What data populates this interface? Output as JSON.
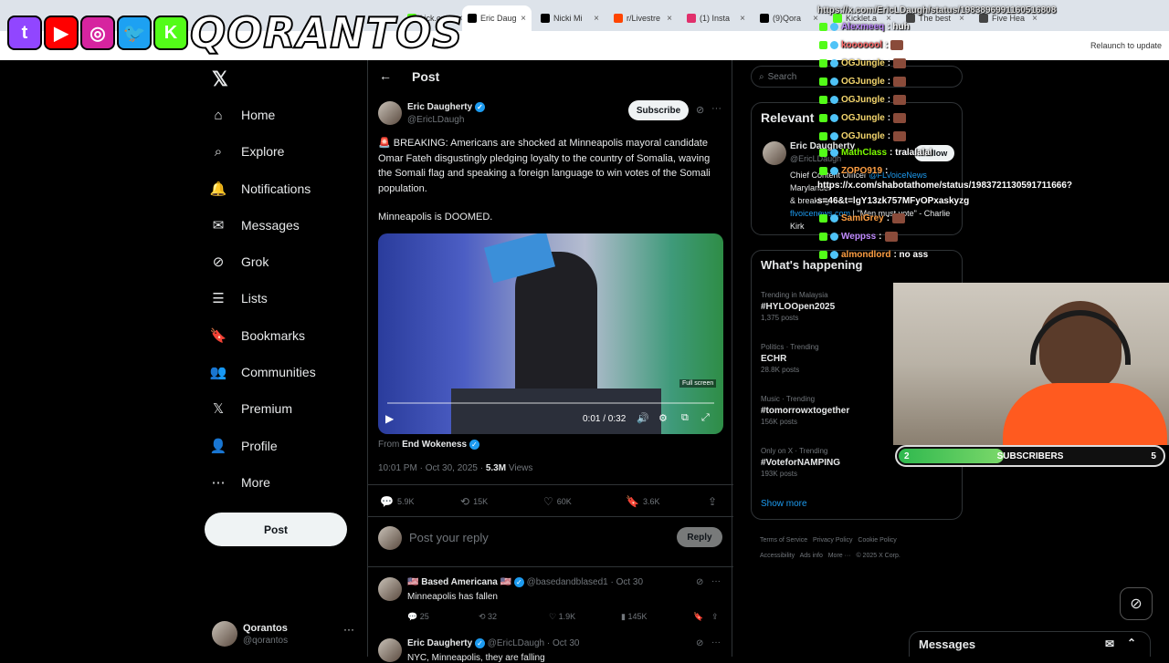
{
  "browser": {
    "tabs": [
      {
        "label": "kick.com",
        "color": "#53fc18"
      },
      {
        "label": "Eric Daug",
        "color": "#000000",
        "active": true
      },
      {
        "label": "Nicki Mi",
        "color": "#000000"
      },
      {
        "label": "r/Livestre",
        "color": "#ff4500"
      },
      {
        "label": "(1) Insta",
        "color": "#e1306c"
      },
      {
        "label": "(9)Qora",
        "color": "#000000"
      },
      {
        "label": "Kicklet.a",
        "color": "#53fc18"
      },
      {
        "label": "The best",
        "color": "#444444"
      },
      {
        "label": "Five Hea",
        "color": "#444444"
      }
    ],
    "relaunch_label": "Relaunch to update"
  },
  "overlay": {
    "logo_text": "QORANTOS",
    "icons": [
      {
        "name": "twitch-icon",
        "glyph": "t",
        "color": "#9146ff"
      },
      {
        "name": "youtube-icon",
        "glyph": "▶",
        "color": "#ff0000"
      },
      {
        "name": "instagram-icon",
        "glyph": "◎",
        "color": "#d6249f"
      },
      {
        "name": "twitter-icon",
        "glyph": "🐦",
        "color": "#1da1f2"
      },
      {
        "name": "kick-icon",
        "glyph": "K",
        "color": "#53fc18"
      }
    ]
  },
  "nav": {
    "items": [
      {
        "label": "Home",
        "icon": "⌂"
      },
      {
        "label": "Explore",
        "icon": "⌕"
      },
      {
        "label": "Notifications",
        "icon": "🔔"
      },
      {
        "label": "Messages",
        "icon": "✉"
      },
      {
        "label": "Grok",
        "icon": "⊘"
      },
      {
        "label": "Lists",
        "icon": "☰"
      },
      {
        "label": "Bookmarks",
        "icon": "🔖"
      },
      {
        "label": "Communities",
        "icon": "👥"
      },
      {
        "label": "Premium",
        "icon": "𝕏"
      },
      {
        "label": "Profile",
        "icon": "👤"
      },
      {
        "label": "More",
        "icon": "⋯"
      }
    ],
    "post_label": "Post",
    "account_name": "Qorantos",
    "account_handle": "@qorantos"
  },
  "post": {
    "header": "Post",
    "author": "Eric Daugherty",
    "handle": "@EricLDaugh",
    "subscribe_label": "Subscribe",
    "text1": "🚨 BREAKING: Americans are shocked at Minneapolis mayoral candidate Omar Fateh disgustingly pledging loyalty to the country of Somalia, waving the Somali flag and speaking a foreign language to win votes of the Somali population.",
    "text2": "Minneapolis is DOOMED.",
    "video_time": "0:01 / 0:32",
    "fullscreen_tooltip": "Full screen",
    "from_label": "From",
    "from_source": "End Wokeness",
    "timestamp": "10:01 PM · Oct 30, 2025 ·",
    "views_count": "5.3M",
    "views_label": "Views",
    "replies": "5.9K",
    "reposts": "15K",
    "likes": "60K",
    "bookmarks": "3.6K",
    "reply_placeholder": "Post your reply",
    "reply_button": "Reply"
  },
  "replies": [
    {
      "author": "🇺🇸 Based Americana 🇺🇸",
      "handle": "@basedandblased1 · Oct 30",
      "text": "Minneapolis has fallen",
      "replies": "25",
      "reposts": "32",
      "likes": "1.9K",
      "views": "145K"
    },
    {
      "author": "Eric Daugherty",
      "handle": "@EricLDaugh · Oct 30",
      "text": "NYC, Minneapolis, they are falling"
    }
  ],
  "sidebar": {
    "search_placeholder": "Search",
    "relevant_title": "Relevant",
    "relevant_name": "Eric Daugherty",
    "relevant_handle": "@EricLDaugh",
    "relevant_bio1": "Chief Content Officer",
    "relevant_bio_link": "@FLVoiceNews",
    "relevant_bio2": "Marylander",
    "relevant_bio3": "& breaking",
    "relevant_site": "flvoicenews.com",
    "relevant_quote": "| \"Men must vote\" - Charlie Kirk",
    "follow_label": "Follow",
    "happening_title": "What's happening",
    "trends": [
      {
        "meta": "Trending in Malaysia",
        "title": "#HYLOOpen2025",
        "count": "1,375 posts"
      },
      {
        "meta": "Politics · Trending",
        "title": "ECHR",
        "count": "28.8K posts"
      },
      {
        "meta": "Music · Trending",
        "title": "#tomorrowxtogether",
        "count": "156K posts"
      },
      {
        "meta": "Only on X · Trending",
        "title": "#VoteforNAMPING",
        "count": "193K posts"
      }
    ],
    "show_more": "Show more",
    "footer": [
      "Terms of Service",
      "Privacy Policy",
      "Cookie Policy",
      "Accessibility",
      "Ads info",
      "More ···",
      "© 2025 X Corp."
    ]
  },
  "chat": [
    {
      "user": "Alexmeeq",
      "msg": ": huh",
      "color": "#c08bff"
    },
    {
      "user": "kooooool",
      "msg": ":",
      "color": "#ff6b6b",
      "emote": true
    },
    {
      "user": "OGJungle",
      "msg": ":",
      "color": "#f5d76e",
      "emote": true
    },
    {
      "user": "OGJungle",
      "msg": ":",
      "color": "#f5d76e",
      "emote": true
    },
    {
      "user": "OGJungle",
      "msg": ":",
      "color": "#f5d76e",
      "emote": true
    },
    {
      "user": "OGJungle",
      "msg": ":",
      "color": "#f5d76e",
      "emote": true
    },
    {
      "user": "OGJungle",
      "msg": ":",
      "color": "#f5d76e",
      "emote": true
    },
    {
      "user": "MathClass",
      "msg": ": tralalalal",
      "color": "#7cfc00"
    },
    {
      "user": "ZOPO919",
      "msg": ":",
      "color": "#ff9f43"
    },
    {
      "user": "SamiGrey",
      "msg": ":",
      "color": "#ff9f43",
      "emote": true
    },
    {
      "user": "Weppss",
      "msg": ":",
      "color": "#c08bff",
      "emote": true
    },
    {
      "user": "almondlord",
      "msg": ": no ass",
      "color": "#ff9f43"
    }
  ],
  "chat_url": "https://x.com/EricLDaugh/status/1983896991160516808",
  "chat_link1": "https://x.com/shabotathome/status/1983721130591711666?",
  "chat_link2": "s=46&t=lgY13zk757MFyOPxaskyzg",
  "subs": {
    "current": "2",
    "label": "SUBSCRIBERS",
    "goal": "5",
    "fill_fraction": 0.4
  },
  "messages_label": "Messages"
}
